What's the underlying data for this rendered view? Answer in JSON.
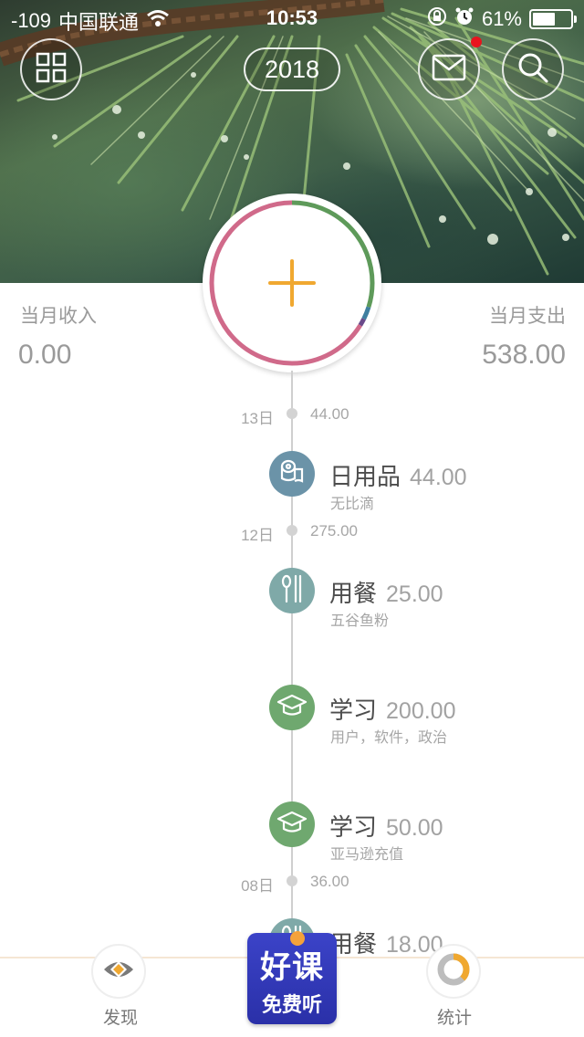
{
  "status_bar": {
    "signal": "-109",
    "carrier": "中国联通",
    "time": "10:53",
    "battery_percent": "61%",
    "battery_level": 0.61
  },
  "header": {
    "year": "2018",
    "menu_icon": "grid-icon",
    "messages_icon": "mail-icon",
    "search_icon": "search-icon",
    "has_new_message": true
  },
  "summary": {
    "income_label": "当月收入",
    "income_value": "0.00",
    "expense_label": "当月支出",
    "expense_value": "538.00"
  },
  "timeline": {
    "days": [
      {
        "date": "13日",
        "total": "44.00"
      },
      {
        "date": "12日",
        "total": "275.00"
      },
      {
        "date": "08日",
        "total": "36.00"
      }
    ],
    "entries": [
      {
        "category": "日用品",
        "amount": "44.00",
        "note": "无比滴",
        "icon": "toilet-paper-icon",
        "color": "#6b93a8"
      },
      {
        "category": "用餐",
        "amount": "25.00",
        "note": "五谷鱼粉",
        "icon": "utensils-icon",
        "color": "#7fa9a8"
      },
      {
        "category": "学习",
        "amount": "200.00",
        "note": "用户，软件，政治",
        "icon": "graduation-cap-icon",
        "color": "#6fa86f"
      },
      {
        "category": "学习",
        "amount": "50.00",
        "note": "亚马逊充值",
        "icon": "graduation-cap-icon",
        "color": "#6fa86f"
      },
      {
        "category": "用餐",
        "amount": "18.00",
        "note": "",
        "icon": "utensils-icon",
        "color": "#7fa9a8"
      }
    ]
  },
  "bottom_bar": {
    "discover_label": "发现",
    "stats_label": "统计",
    "promo_line1": "好课",
    "promo_line2": "免费听"
  },
  "colors": {
    "accent_plus": "#f0a830",
    "text_gray": "#9a9a9a",
    "timeline_line": "#cfcfcf"
  }
}
